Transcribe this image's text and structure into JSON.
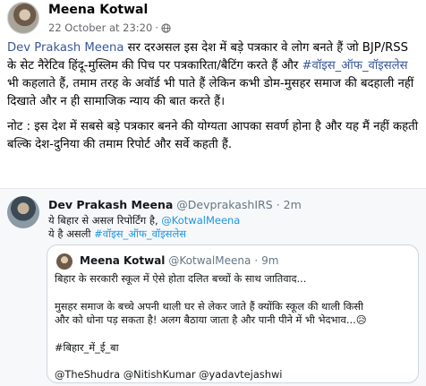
{
  "post": {
    "author": "Meena Kotwal",
    "timestamp": "22 October at 23:20",
    "meta_sep": "·",
    "privacy_icon": "globe-icon",
    "paragraph1": {
      "mention": "Dev Prakash Meena",
      "text_a": " सर दरअसल इस देश में बड़े पत्रकार वे लोग बनते हैं जो BJP/RSS के सेट नैरेटिव हिंदू-मुस्लिम की पिच पर पत्रकारिता/बैटिंग करते हैं और ",
      "hashtag": "#वॉइस_ऑफ_वॉइसलेस",
      "text_b": " भी कहलाते हैं, तमाम तरह के अवॉर्ड भी पाते हैं लेकिन कभी डोम-मुसहर समाज की बदहाली नहीं दिखाते और न ही सामाजिक न्याय की बात करते हैं।"
    },
    "paragraph2": "नोट : इस देश में सबसे बड़े पत्रकार बनने की योग्यता आपका सवर्ण होना है और यह मैं नहीं कहती बल्कि देश-दुनिया की तमाम रिपोर्ट और सर्वे कहती हैं."
  },
  "tweet": {
    "name": "Dev Prakash Meena",
    "handle": "@DevprakashIRS",
    "dot": "·",
    "time": "2m",
    "line1_text": "ये बिहार से असल रिपोर्टिंग है, ",
    "line1_mention": "@KotwalMeena",
    "line2_text": "ये है असली ",
    "line2_hashtag": "#वॉइस_ऑफ_वॉइसलेस"
  },
  "quoted": {
    "name": "Meena Kotwal",
    "handle": "@KotwalMeena",
    "dot": "·",
    "time": "9m",
    "line1": "बिहार के सरकारी स्कूल में ऐसे होता दलित बच्चों के साथ जातिवाद...",
    "line2": "मुसहर समाज के बच्चे अपनी थाली घर से लेकर जाते हैं क्योंकि स्कूल की थाली किसी",
    "line3": "और को धोना पड़ सकता है! अलग बैठाया जाता है और पानी पीने में भी भेदभाव...😥",
    "hashtag": "#बिहार_में_ई_बा",
    "mentions": "@TheShudra @NitishKumar @yadavtejashwi"
  },
  "colors": {
    "link": "#385898",
    "twitter_link": "#1b95e0",
    "secondary_text": "#65676b"
  }
}
